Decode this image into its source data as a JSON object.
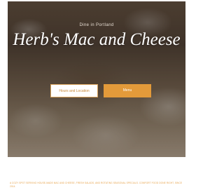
{
  "hero": {
    "eyebrow": "Dine in Portland",
    "title": "Herb's Mac and Cheese"
  },
  "buttons": {
    "hours_label": "Hours and Location",
    "menu_label": "Menu"
  },
  "footer": {
    "text": "A cozy spot serving house-made mac and cheese, fresh salads, and rotating seasonal specials. Comfort food done right, since 2014."
  },
  "colors": {
    "accent": "#e39a3a",
    "accent_text": "#c98a3a",
    "footer_text": "#e6a24a"
  }
}
